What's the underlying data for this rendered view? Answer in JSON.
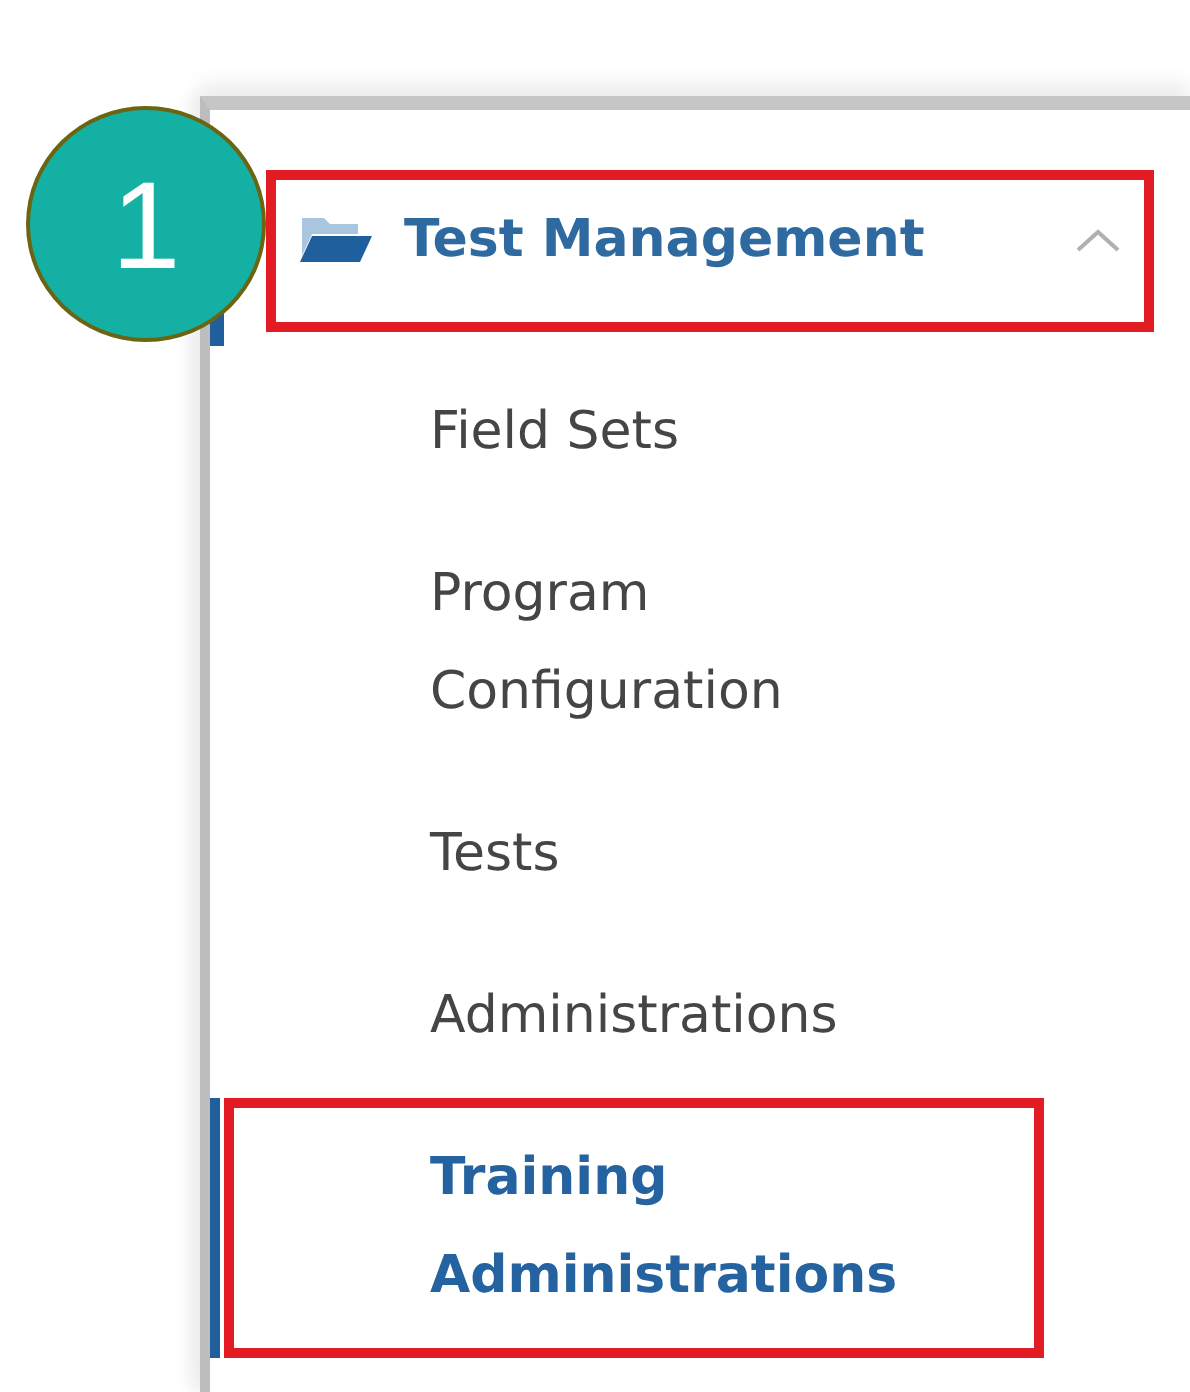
{
  "annotation": {
    "label": "1"
  },
  "menu": {
    "title": "Test Management",
    "expanded": true,
    "highlighted": true,
    "items": [
      {
        "label": "Field Sets",
        "selected": false,
        "highlighted": false
      },
      {
        "label": "Program Configuration",
        "selected": false,
        "highlighted": false
      },
      {
        "label": "Tests",
        "selected": false,
        "highlighted": false
      },
      {
        "label": "Administrations",
        "selected": false,
        "highlighted": false
      },
      {
        "label": "Training Administrations",
        "selected": true,
        "highlighted": true
      }
    ]
  }
}
